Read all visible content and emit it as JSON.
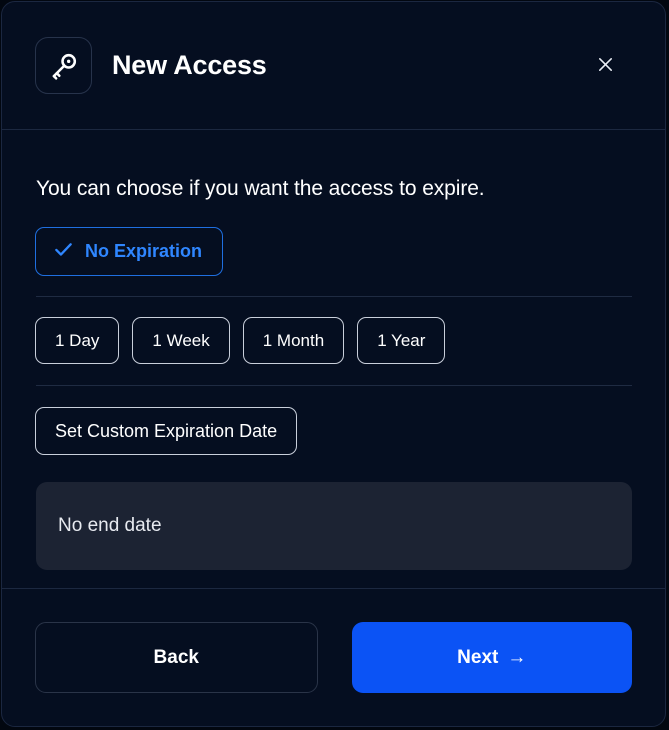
{
  "header": {
    "icon": "key-icon",
    "title": "New Access",
    "close_icon": "close-icon"
  },
  "body": {
    "lead_text": "You can choose if you want the access to expire.",
    "selected_option": {
      "label": "No Expiration",
      "check_icon": "check-icon",
      "accent_color": "#2f86ff"
    },
    "duration_options": [
      {
        "label": "1 Day"
      },
      {
        "label": "1 Week"
      },
      {
        "label": "1 Month"
      },
      {
        "label": "1 Year"
      }
    ],
    "custom_date_label": "Set Custom Expiration Date",
    "end_date_value": "No end date"
  },
  "footer": {
    "back_label": "Back",
    "next_label": "Next",
    "next_arrow": "→",
    "next_color": "#0b53f5"
  }
}
